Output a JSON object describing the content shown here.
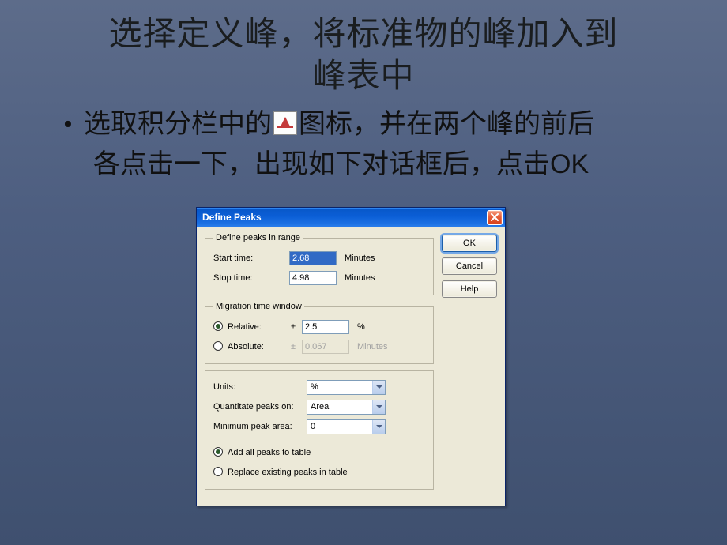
{
  "slide": {
    "title_l1": "选择定义峰，将标准物的峰加入到",
    "title_l2": "峰表中",
    "body_l1_pre": "选取积分栏中的",
    "body_l1_post": "图标，并在两个峰的前后",
    "body_l2": "各点击一下，出现如下对话框后，点击",
    "body_l2_ok": "OK",
    "bullet": "•"
  },
  "dialog": {
    "title": "Define Peaks",
    "group_range": {
      "legend": "Define peaks in range",
      "start_label": "Start time:",
      "start_value": "2.68",
      "stop_label": "Stop time:",
      "stop_value": "4.98",
      "unit": "Minutes"
    },
    "group_migration": {
      "legend": "Migration time window",
      "relative_label": "Relative:",
      "relative_value": "2.5",
      "relative_unit": "%",
      "absolute_label": "Absolute:",
      "absolute_value": "0.067",
      "absolute_unit": "Minutes",
      "pm": "±"
    },
    "units_section": {
      "units_label": "Units:",
      "units_value": "%",
      "quant_label": "Quantitate peaks on:",
      "quant_value": "Area",
      "min_area_label": "Minimum peak area:",
      "min_area_value": "0"
    },
    "radios": {
      "add_all": "Add all peaks to table",
      "replace": "Replace existing peaks in table"
    },
    "buttons": {
      "ok": "OK",
      "cancel": "Cancel",
      "help": "Help"
    }
  }
}
